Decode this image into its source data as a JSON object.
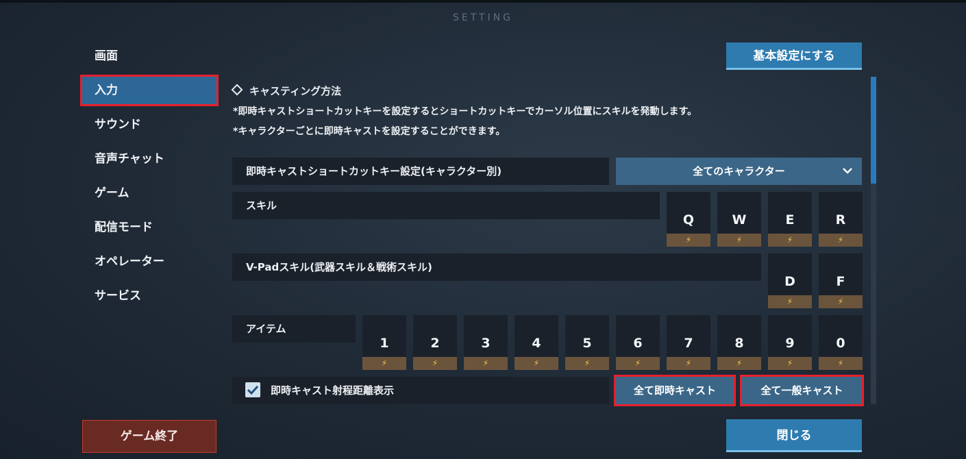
{
  "window": {
    "title": "SETTING"
  },
  "sidebar": {
    "items": [
      {
        "label": "画面"
      },
      {
        "label": "入力"
      },
      {
        "label": "サウンド"
      },
      {
        "label": "音声チャット"
      },
      {
        "label": "ゲーム"
      },
      {
        "label": "配信モード"
      },
      {
        "label": "オペレーター"
      },
      {
        "label": "サービス"
      }
    ],
    "exit_label": "ゲーム終了"
  },
  "header": {
    "default_button": "基本設定にする"
  },
  "section": {
    "title": "キャスティング方法",
    "note1": "*即時キャストショートカットキーを設定するとショートカットキーでカーソル位置にスキルを発動します。",
    "note2": "*キャラクターごとに即時キャストを設定することができます。"
  },
  "shortcut_row": {
    "label": "即時キャストショートカットキー設定(キャラクター別)",
    "dropdown_value": "全てのキャラクター"
  },
  "skill_row": {
    "label": "スキル",
    "keys": [
      "Q",
      "W",
      "E",
      "R"
    ]
  },
  "vpad_row": {
    "label": "V-Padスキル(武器スキル＆戦術スキル)",
    "keys": [
      "D",
      "F"
    ]
  },
  "item_row": {
    "label": "アイテム",
    "keys": [
      "1",
      "2",
      "3",
      "4",
      "5",
      "6",
      "7",
      "8",
      "9",
      "0"
    ]
  },
  "range_row": {
    "checkbox_label": "即時キャスト射程距離表示",
    "checked": true,
    "all_quick_label": "全て即時キャスト",
    "all_normal_label": "全て一般キャスト"
  },
  "footer": {
    "close_label": "閉じる"
  },
  "colors": {
    "accent": "#2e7bb0",
    "highlight": "#e8202c",
    "bolt": "#f4c64a"
  }
}
